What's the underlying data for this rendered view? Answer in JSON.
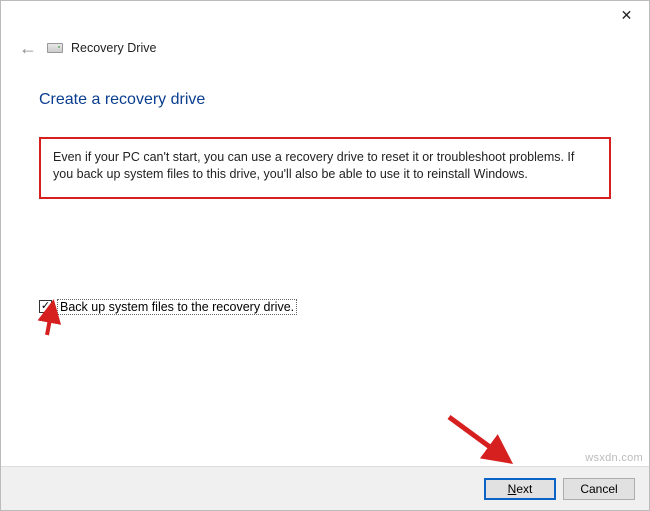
{
  "window": {
    "close_symbol": "✕"
  },
  "header": {
    "title": "Recovery Drive"
  },
  "page": {
    "heading": "Create a recovery drive",
    "description": "Even if your PC can't start, you can use a recovery drive to reset it or troubleshoot problems. If you back up system files to this drive, you'll also be able to use it to reinstall Windows."
  },
  "checkbox": {
    "checked_symbol": "✓",
    "label": "Back up system files to the recovery drive."
  },
  "footer": {
    "next_prefix": "",
    "next_hot": "N",
    "next_rest": "ext",
    "cancel": "Cancel"
  },
  "watermark": "wsxdn.com"
}
